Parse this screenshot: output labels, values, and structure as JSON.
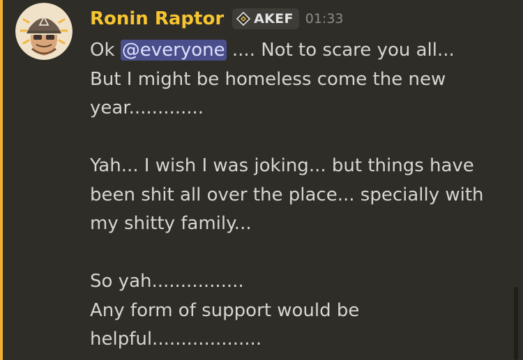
{
  "message": {
    "author": "Ronin Raptor",
    "role_tag": "AKEF",
    "role_icon": "diamond-role-icon",
    "timestamp": "01:33",
    "mention": "@everyone",
    "line1_prefix": "Ok ",
    "line1_suffix": " .... Not to scare you all...",
    "lines_block1": [
      "But I might be homeless come the new",
      "year............."
    ],
    "lines_block2": [
      "Yah... I wish I was joking... but things have",
      "been shit all over the place... specially with",
      "my shitty family..."
    ],
    "lines_block3": [
      "So yah................",
      "Any form of support would be",
      "helpful..................."
    ]
  },
  "colors": {
    "background": "#2f2d28",
    "mention_bar": "#f0b232",
    "username": "#f7c531",
    "mention_bg": "#4a4f8c",
    "text": "#d8d6d1",
    "timestamp": "#8f8d88"
  }
}
